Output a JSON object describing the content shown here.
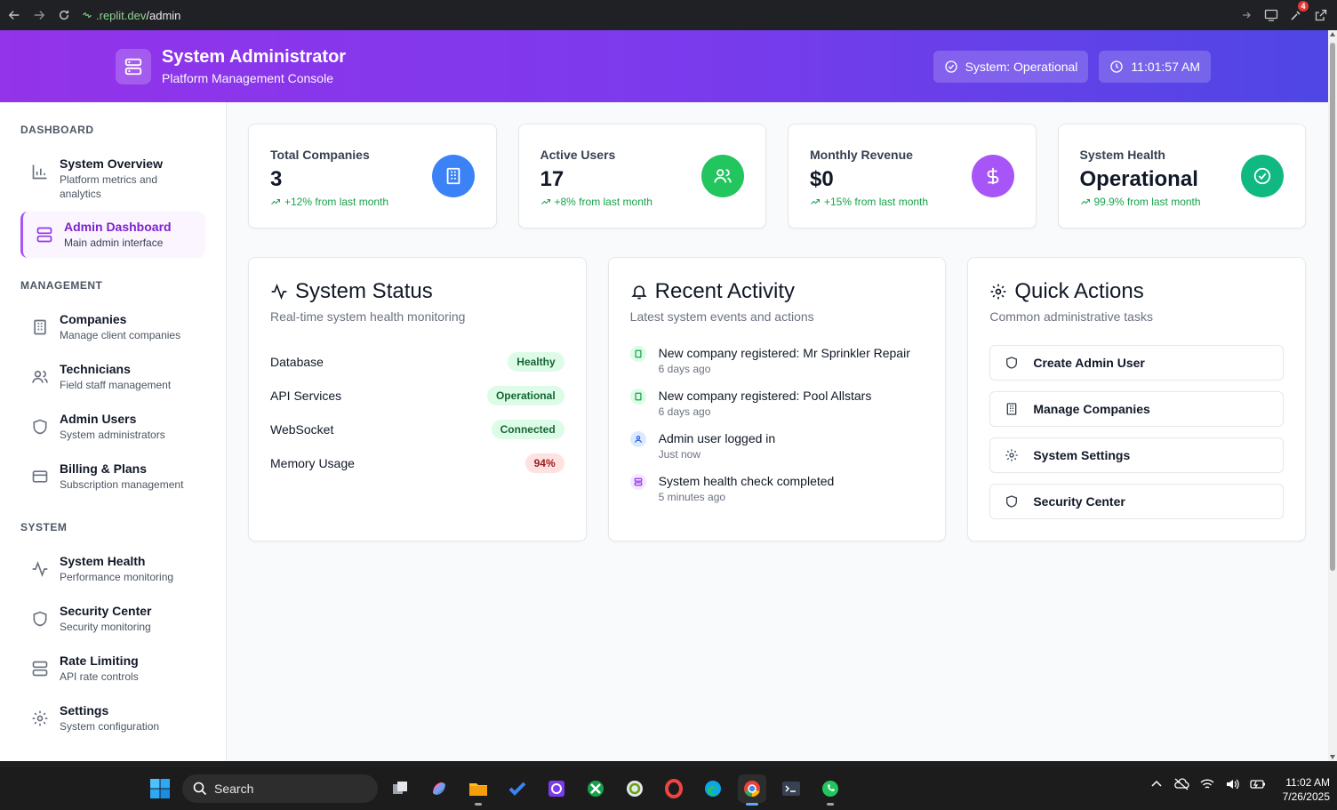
{
  "browser": {
    "url_host": ".replit.dev",
    "url_path": "/admin",
    "extension_badge": "4"
  },
  "header": {
    "title": "System Administrator",
    "subtitle": "Platform Management Console",
    "status_pill": "System: Operational",
    "time_pill": "11:01:57 AM"
  },
  "sidebar": {
    "sections": [
      {
        "title": "DASHBOARD",
        "items": [
          {
            "title": "System Overview",
            "sub": "Platform metrics and analytics",
            "icon": "bar-chart-icon"
          },
          {
            "title": "Admin Dashboard",
            "sub": "Main admin interface",
            "icon": "server-icon",
            "active": true
          }
        ]
      },
      {
        "title": "MANAGEMENT",
        "items": [
          {
            "title": "Companies",
            "sub": "Manage client companies",
            "icon": "building-icon"
          },
          {
            "title": "Technicians",
            "sub": "Field staff management",
            "icon": "users-icon"
          },
          {
            "title": "Admin Users",
            "sub": "System administrators",
            "icon": "shield-icon"
          },
          {
            "title": "Billing & Plans",
            "sub": "Subscription management",
            "icon": "credit-card-icon"
          }
        ]
      },
      {
        "title": "SYSTEM",
        "items": [
          {
            "title": "System Health",
            "sub": "Performance monitoring",
            "icon": "activity-icon"
          },
          {
            "title": "Security Center",
            "sub": "Security monitoring",
            "icon": "shield-icon"
          },
          {
            "title": "Rate Limiting",
            "sub": "API rate controls",
            "icon": "server-icon"
          },
          {
            "title": "Settings",
            "sub": "System configuration",
            "icon": "gear-icon"
          }
        ]
      }
    ]
  },
  "stats": [
    {
      "label": "Total Companies",
      "value": "3",
      "trend": "+12% from last month",
      "icon": "building-icon",
      "color": "#3b82f6"
    },
    {
      "label": "Active Users",
      "value": "17",
      "trend": "+8% from last month",
      "icon": "users-icon",
      "color": "#22c55e"
    },
    {
      "label": "Monthly Revenue",
      "value": "$0",
      "trend": "+15% from last month",
      "icon": "dollar-icon",
      "color": "#a855f7"
    },
    {
      "label": "System Health",
      "value": "Operational",
      "trend": "99.9% from last month",
      "icon": "check-circle-icon",
      "color": "#10b981"
    }
  ],
  "system_status": {
    "title": "System Status",
    "subtitle": "Real-time system health monitoring",
    "rows": [
      {
        "label": "Database",
        "status": "Healthy",
        "tone": "green"
      },
      {
        "label": "API Services",
        "status": "Operational",
        "tone": "green"
      },
      {
        "label": "WebSocket",
        "status": "Connected",
        "tone": "green"
      },
      {
        "label": "Memory Usage",
        "status": "94%",
        "tone": "red"
      }
    ]
  },
  "recent_activity": {
    "title": "Recent Activity",
    "subtitle": "Latest system events and actions",
    "items": [
      {
        "title": "New company registered: Mr Sprinkler Repair",
        "time": "6 days ago",
        "icon": "building-icon",
        "color": "#dcfce7",
        "fg": "#16a34a"
      },
      {
        "title": "New company registered: Pool Allstars",
        "time": "6 days ago",
        "icon": "building-icon",
        "color": "#dcfce7",
        "fg": "#16a34a"
      },
      {
        "title": "Admin user logged in",
        "time": "Just now",
        "icon": "user-icon",
        "color": "#dbeafe",
        "fg": "#2563eb"
      },
      {
        "title": "System health check completed",
        "time": "5 minutes ago",
        "icon": "server-icon",
        "color": "#f3e8ff",
        "fg": "#9333ea"
      }
    ]
  },
  "quick_actions": {
    "title": "Quick Actions",
    "subtitle": "Common administrative tasks",
    "buttons": [
      {
        "label": "Create Admin User",
        "icon": "shield-icon"
      },
      {
        "label": "Manage Companies",
        "icon": "building-icon"
      },
      {
        "label": "System Settings",
        "icon": "gear-icon"
      },
      {
        "label": "Security Center",
        "icon": "shield-icon"
      }
    ]
  },
  "taskbar": {
    "search_label": "Search",
    "time": "11:02 AM",
    "date": "7/26/2025"
  }
}
